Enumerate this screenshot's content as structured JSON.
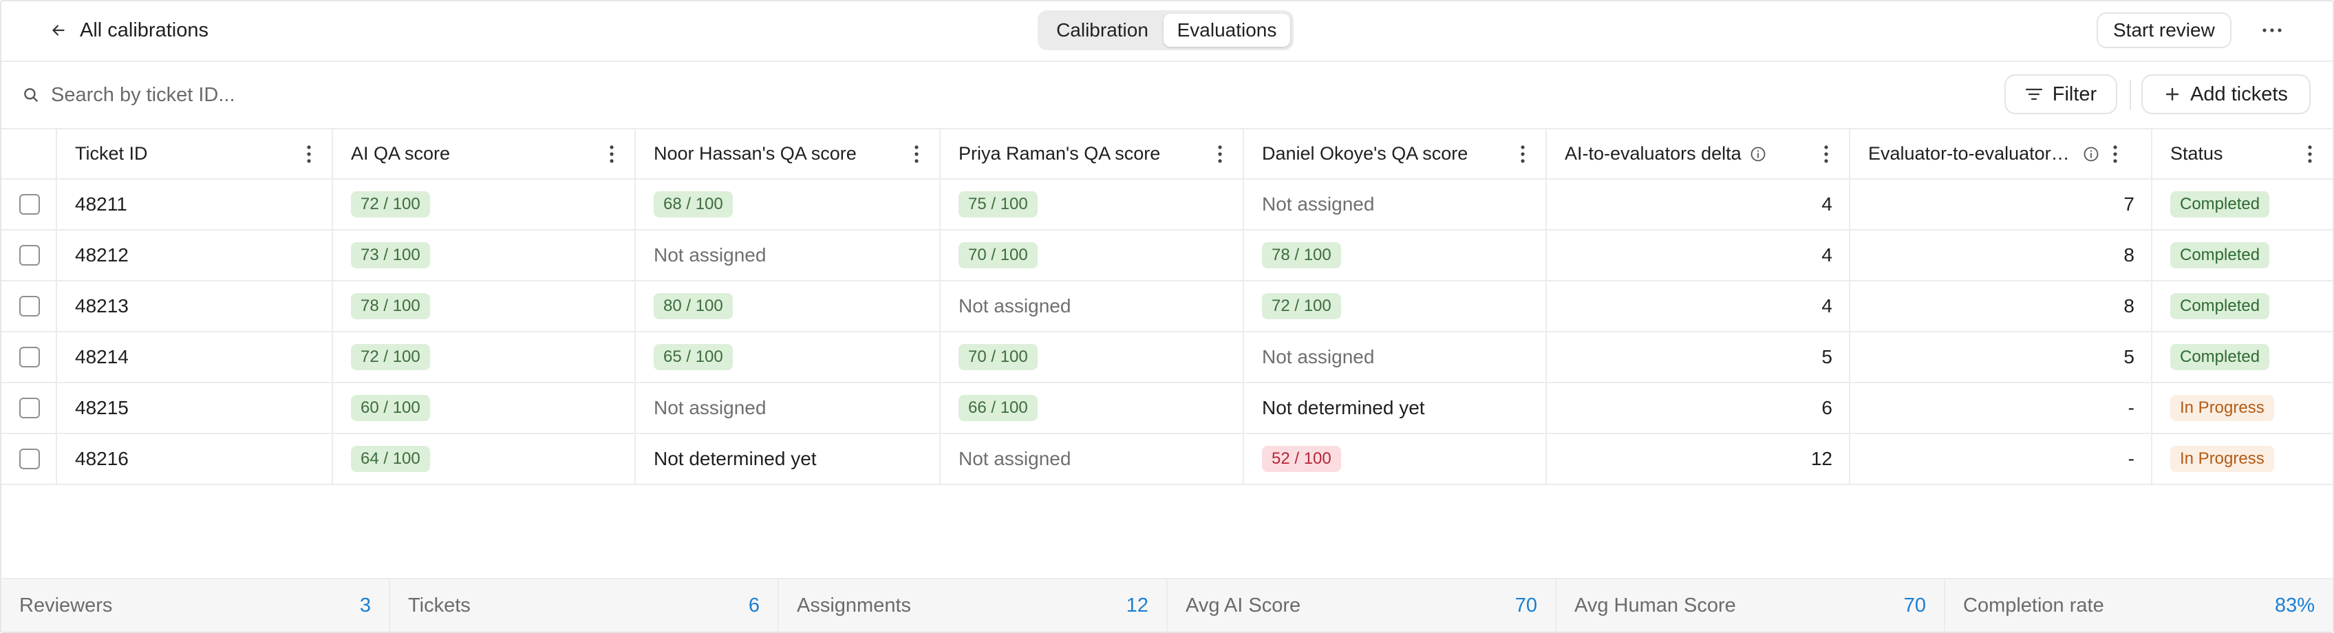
{
  "header": {
    "back_label": "All calibrations",
    "tabs": [
      "Calibration",
      "Evaluations"
    ],
    "active_tab": "Evaluations",
    "start_review_label": "Start review"
  },
  "search": {
    "placeholder": "Search by ticket ID..."
  },
  "toolbar": {
    "filter_label": "Filter",
    "add_tickets_label": "Add tickets"
  },
  "table": {
    "columns": [
      "Ticket ID",
      "AI QA score",
      "Noor Hassan's QA score",
      "Priya Raman's QA score",
      "Daniel Okoye's QA score",
      "AI-to-evaluators delta",
      "Evaluator-to-evaluator delta",
      "Status"
    ],
    "rows": [
      [
        "48211",
        "72 / 100",
        "68 / 100",
        "75 / 100",
        "Not assigned",
        "4",
        "7",
        "Completed"
      ],
      [
        "48212",
        "73 / 100",
        "Not assigned",
        "70 / 100",
        "78 / 100",
        "4",
        "8",
        "Completed"
      ],
      [
        "48213",
        "78 / 100",
        "80 / 100",
        "Not assigned",
        "72 / 100",
        "4",
        "8",
        "Completed"
      ],
      [
        "48214",
        "72 / 100",
        "65 / 100",
        "70 / 100",
        "Not assigned",
        "5",
        "5",
        "Completed"
      ],
      [
        "48215",
        "60 / 100",
        "Not assigned",
        "66 / 100",
        "Not determined yet",
        "6",
        "-",
        "In Progress"
      ],
      [
        "48216",
        "64 / 100",
        "Not determined yet",
        "Not assigned",
        "52 / 100",
        "12",
        "-",
        "In Progress"
      ]
    ]
  },
  "stats": [
    {
      "label": "Reviewers",
      "value": "3"
    },
    {
      "label": "Tickets",
      "value": "6"
    },
    {
      "label": "Assignments",
      "value": "12"
    },
    {
      "label": "Avg AI Score",
      "value": "70"
    },
    {
      "label": "Avg Human Score",
      "value": "70"
    },
    {
      "label": "Completion rate",
      "value": "83%"
    }
  ],
  "colors": {
    "score_good_bg": "#dcefd9",
    "score_low_bg": "#fbdde1",
    "completed_bg": "#dcefd9",
    "in_progress_bg": "#fbeee2",
    "stat_value": "#1a7fd4"
  },
  "icons": [
    "arrow-left-icon",
    "more-horizontal-icon",
    "search-icon",
    "filter-icon",
    "plus-icon",
    "more-vertical-icon",
    "info-icon"
  ]
}
